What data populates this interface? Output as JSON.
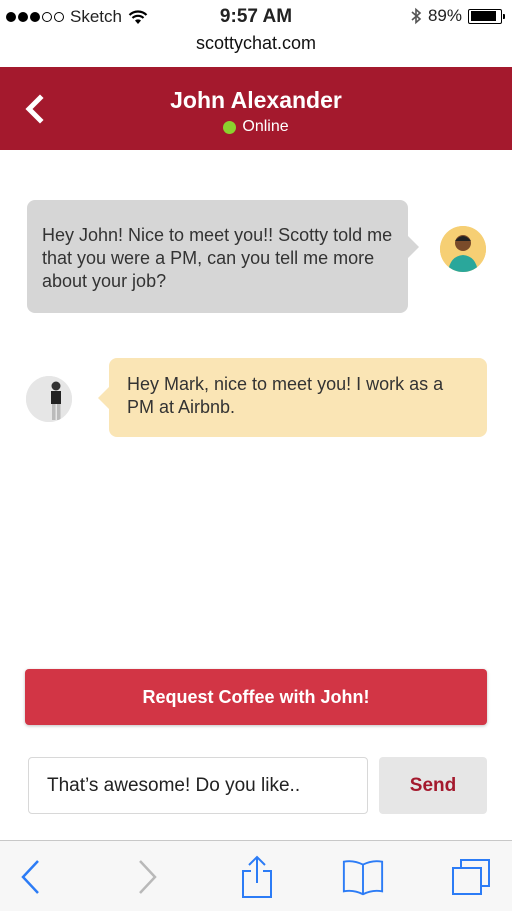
{
  "status_bar": {
    "carrier": "Sketch",
    "time": "9:57 AM",
    "battery_percent": "89%",
    "battery_level": 0.89,
    "signal_bars_filled": 3,
    "signal_bars_total": 5
  },
  "browser": {
    "url": "scottychat.com"
  },
  "header": {
    "name": "John Alexander",
    "status": "Online",
    "status_color": "#8bd22e",
    "background": "#a4192d"
  },
  "messages": [
    {
      "from": "john",
      "text": "Hey John! Nice to meet you!! Scotty told me that you were a PM, can you tell me more about your job?"
    },
    {
      "from": "mark",
      "text": "Hey Mark, nice to meet you! I work as a PM at Airbnb."
    }
  ],
  "actions": {
    "request_label": "Request Coffee with John!"
  },
  "composer": {
    "value": "That’s awesome! Do you like..",
    "send_label": "Send"
  },
  "toolbar": {
    "items": [
      "back-icon",
      "forward-icon",
      "share-icon",
      "bookmarks-icon",
      "tabs-icon"
    ]
  }
}
